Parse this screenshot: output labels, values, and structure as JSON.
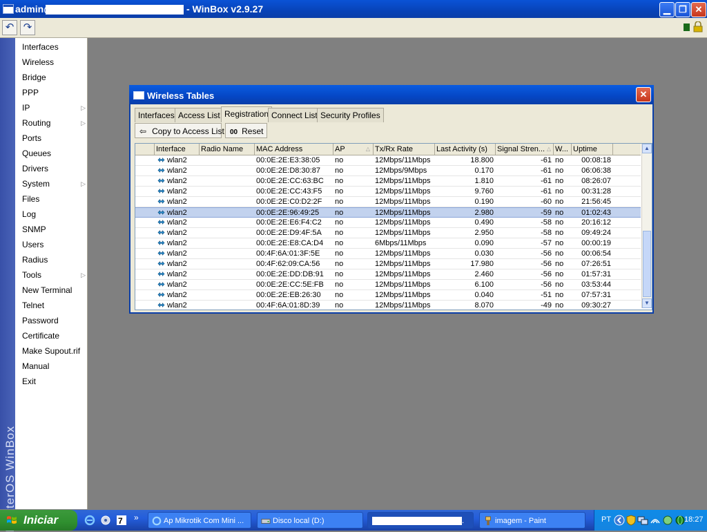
{
  "window": {
    "title_prefix": "admin@",
    "title_suffix": "- WinBox v2.9.27",
    "minimize": "▁",
    "maximize": "❐",
    "close": "✕"
  },
  "toolbar": {
    "undo": "↶",
    "redo": "↷",
    "status_color": "#1a6a1a",
    "lock_color": "#d8b400"
  },
  "sidebar": {
    "brand": "RouterOS WinBox",
    "items": [
      {
        "label": "Interfaces"
      },
      {
        "label": "Wireless"
      },
      {
        "label": "Bridge"
      },
      {
        "label": "PPP"
      },
      {
        "label": "IP",
        "submenu": "▷"
      },
      {
        "label": "Routing",
        "submenu": "▷"
      },
      {
        "label": "Ports"
      },
      {
        "label": "Queues"
      },
      {
        "label": "Drivers"
      },
      {
        "label": "System",
        "submenu": "▷"
      },
      {
        "label": "Files"
      },
      {
        "label": "Log"
      },
      {
        "label": "SNMP"
      },
      {
        "label": "Users"
      },
      {
        "label": "Radius"
      },
      {
        "label": "Tools",
        "submenu": "▷"
      },
      {
        "label": "New Terminal"
      },
      {
        "label": "Telnet"
      },
      {
        "label": "Password"
      },
      {
        "label": "Certificate"
      },
      {
        "label": "Make Supout.rif"
      },
      {
        "label": "Manual"
      },
      {
        "label": "Exit"
      }
    ]
  },
  "dialog": {
    "title": "Wireless Tables",
    "close": "✕",
    "tabs": [
      "Interfaces",
      "Access List",
      "Registration",
      "Connect List",
      "Security Profiles"
    ],
    "active_tab": "Registration",
    "copy_label": "Copy to Access List",
    "copy_icon": "⇦",
    "reset_label": "Reset",
    "reset_icon": "00",
    "columns": [
      "",
      "Interface",
      "Radio Name",
      "MAC Address",
      "AP",
      "Tx/Rx Rate",
      "Last Activity (s)",
      "Signal Stren...",
      "W...",
      "Uptime"
    ],
    "sort_marks": {
      "ap": "△",
      "signal": "△"
    },
    "rows": [
      {
        "iface": "wlan2",
        "radio": "",
        "mac": "00:0E:2E:E3:38:05",
        "ap": "no",
        "rate": "12Mbps/11Mbps",
        "last": "18.800",
        "signal": "-61",
        "w": "no",
        "uptime": "00:08:18"
      },
      {
        "iface": "wlan2",
        "radio": "",
        "mac": "00:0E:2E:D8:30:87",
        "ap": "no",
        "rate": "12Mbps/9Mbps",
        "last": "0.170",
        "signal": "-61",
        "w": "no",
        "uptime": "06:06:38"
      },
      {
        "iface": "wlan2",
        "radio": "",
        "mac": "00:0E:2E:CC:63:BC",
        "ap": "no",
        "rate": "12Mbps/11Mbps",
        "last": "1.810",
        "signal": "-61",
        "w": "no",
        "uptime": "08:26:07"
      },
      {
        "iface": "wlan2",
        "radio": "",
        "mac": "00:0E:2E:CC:43:F5",
        "ap": "no",
        "rate": "12Mbps/11Mbps",
        "last": "9.760",
        "signal": "-61",
        "w": "no",
        "uptime": "00:31:28"
      },
      {
        "iface": "wlan2",
        "radio": "",
        "mac": "00:0E:2E:C0:D2:2F",
        "ap": "no",
        "rate": "12Mbps/11Mbps",
        "last": "0.190",
        "signal": "-60",
        "w": "no",
        "uptime": "21:56:45"
      },
      {
        "iface": "wlan2",
        "radio": "",
        "mac": "00:0E:2E:96:49:25",
        "ap": "no",
        "rate": "12Mbps/11Mbps",
        "last": "2.980",
        "signal": "-59",
        "w": "no",
        "uptime": "01:02:43",
        "selected": true
      },
      {
        "iface": "wlan2",
        "radio": "",
        "mac": "00:0E:2E:E6:F4:C2",
        "ap": "no",
        "rate": "12Mbps/11Mbps",
        "last": "0.490",
        "signal": "-58",
        "w": "no",
        "uptime": "20:16:12"
      },
      {
        "iface": "wlan2",
        "radio": "",
        "mac": "00:0E:2E:D9:4F:5A",
        "ap": "no",
        "rate": "12Mbps/11Mbps",
        "last": "2.950",
        "signal": "-58",
        "w": "no",
        "uptime": "09:49:24"
      },
      {
        "iface": "wlan2",
        "radio": "",
        "mac": "00:0E:2E:E8:CA:D4",
        "ap": "no",
        "rate": "6Mbps/11Mbps",
        "last": "0.090",
        "signal": "-57",
        "w": "no",
        "uptime": "00:00:19"
      },
      {
        "iface": "wlan2",
        "radio": "",
        "mac": "00:4F:6A:01:3F:5E",
        "ap": "no",
        "rate": "12Mbps/11Mbps",
        "last": "0.030",
        "signal": "-56",
        "w": "no",
        "uptime": "00:06:54"
      },
      {
        "iface": "wlan2",
        "radio": "",
        "mac": "00:4F:62:09:CA:56",
        "ap": "no",
        "rate": "12Mbps/11Mbps",
        "last": "17.980",
        "signal": "-56",
        "w": "no",
        "uptime": "07:26:51"
      },
      {
        "iface": "wlan2",
        "radio": "",
        "mac": "00:0E:2E:DD:DB:91",
        "ap": "no",
        "rate": "12Mbps/11Mbps",
        "last": "2.460",
        "signal": "-56",
        "w": "no",
        "uptime": "01:57:31"
      },
      {
        "iface": "wlan2",
        "radio": "",
        "mac": "00:0E:2E:CC:5E:FB",
        "ap": "no",
        "rate": "12Mbps/11Mbps",
        "last": "6.100",
        "signal": "-56",
        "w": "no",
        "uptime": "03:53:44"
      },
      {
        "iface": "wlan2",
        "radio": "",
        "mac": "00:0E:2E:EB:26:30",
        "ap": "no",
        "rate": "12Mbps/11Mbps",
        "last": "0.040",
        "signal": "-51",
        "w": "no",
        "uptime": "07:57:31"
      },
      {
        "iface": "wlan2",
        "radio": "",
        "mac": "00:4F:6A:01:8D:39",
        "ap": "no",
        "rate": "12Mbps/11Mbps",
        "last": "8.070",
        "signal": "-49",
        "w": "no",
        "uptime": "09:30:27"
      }
    ],
    "scroll_up": "▲",
    "scroll_down": "▼"
  },
  "taskbar": {
    "start_label": "Iniciar",
    "overflow": "»",
    "tasks": [
      {
        "label": "Ap Mikrotik Com Mini ...",
        "icon": "ie-icon"
      },
      {
        "label": "Disco local (D:)",
        "icon": "drive-icon"
      },
      {
        "label": ".",
        "icon": "redacted"
      },
      {
        "label": "imagem - Paint",
        "icon": "paint-icon"
      }
    ],
    "lang": "PT",
    "clock": "18:27"
  }
}
